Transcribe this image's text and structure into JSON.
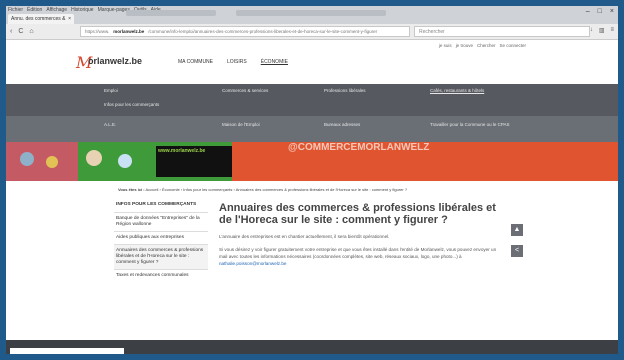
{
  "browser": {
    "menu": [
      "Fichier",
      "Édition",
      "Affichage",
      "Historique",
      "Marque-pages",
      "Outils",
      "Aide"
    ],
    "tab_title": "Annu. des commerces & ...",
    "tab_close": "×",
    "url_prefix": "https://www.",
    "url_domain": "morlanwelz.be",
    "url_rest": "/commune/info-lemploi/annuaires-des-commerces-professions-liberales-et-de-horeca-sur-le-site-comment-y-figurer",
    "search_placeholder": "Rechercher",
    "back": "‹",
    "reload": "C",
    "home": "⌂",
    "min": "–",
    "max": "□",
    "close": "×"
  },
  "site": {
    "top_links": [
      "je suis",
      "je trouve",
      "Chercher",
      "Se connecter"
    ],
    "logo_letter": "M",
    "logo_text": "orlanwelz.be",
    "nav": [
      "MA COMMUNE",
      "LOISIRS",
      "ÉCONOMIE"
    ]
  },
  "mega": {
    "col1": [
      "Emploi",
      "Infos pour les commerçants"
    ],
    "row1": [
      "Commerces & services",
      "Professions libérales",
      "Cafés, restaurants & hôtels"
    ],
    "row2": [
      "A.L.E.",
      "Maison de l'Emploi",
      "Bureaux adresses",
      "Travailler pour la Commune ou le CPAS"
    ]
  },
  "banner": {
    "small_text": "www.morlanwelz.be",
    "big_text": "@COMMERCEMORLANWELZ"
  },
  "breadcrumb": {
    "label": "Vous êtes ici :",
    "path": "Accueil › Économie › Infos pour les commerçants › Annuaires des commerces & professions libérales et de l'Horeca sur le site : comment y figurer ?"
  },
  "sidebar": {
    "heading": "INFOS POUR LES COMMERÇANTS",
    "items": [
      "Banque de données \"Entreprises\" de la Région wallonne",
      "Aides publiques aux entreprises",
      "Annuaires des commerces & professions libérales et de l'Horeca sur le site : comment y figurer ?",
      "Taxes et redevances communales"
    ]
  },
  "article": {
    "title": "Annuaires des commerces & professions libérales et de l'Horeca sur le site : comment y figurer ?",
    "lead": "L'annuaire des entreprises est en chantier actuellement, il sera bientôt opérationnel.",
    "body": "Si vous désirez y voir figurer gratuitement votre entreprise et que vous êtes installé dans l'entité de Morlanwelz, vous pouvez envoyer un mail avec toutes les informations nécessaires (coordonnées complètes, site web, réseaux sociaux, logo, une photo...) à",
    "email": "nathalie.poisson@morlanwelz.be"
  },
  "share": {
    "print": "▲",
    "share": "<"
  }
}
